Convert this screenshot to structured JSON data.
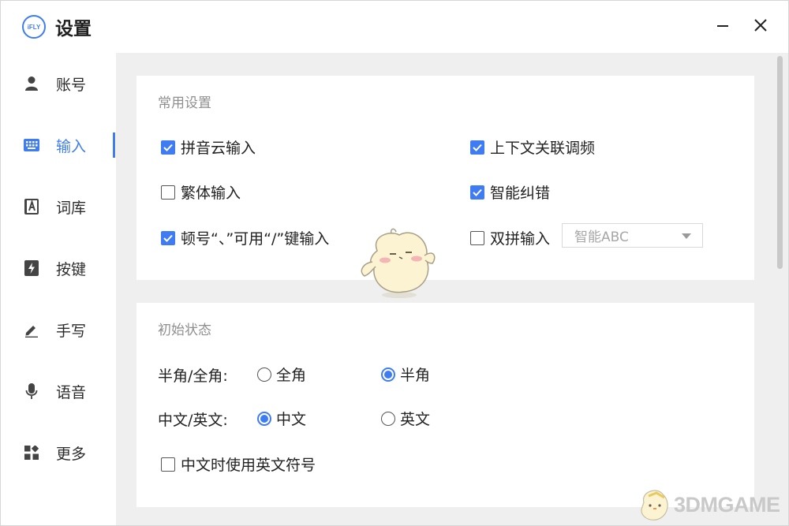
{
  "app": {
    "logo_text": "iFLY",
    "title": "设置"
  },
  "sidebar": {
    "items": [
      {
        "label": "账号",
        "icon": "user-icon"
      },
      {
        "label": "输入",
        "icon": "keyboard-icon",
        "active": true
      },
      {
        "label": "词库",
        "icon": "dictionary-icon"
      },
      {
        "label": "按键",
        "icon": "key-flash-icon"
      },
      {
        "label": "手写",
        "icon": "pen-icon"
      },
      {
        "label": "语音",
        "icon": "microphone-icon"
      },
      {
        "label": "更多",
        "icon": "more-grid-icon"
      }
    ]
  },
  "window_controls": {
    "minimize": "minimize-icon",
    "close": "close-icon"
  },
  "common": {
    "title": "常用设置",
    "options": {
      "pinyin_cloud": {
        "label": "拼音云输入",
        "checked": true
      },
      "context_freq": {
        "label": "上下文关联调频",
        "checked": true
      },
      "traditional": {
        "label": "繁体输入",
        "checked": false
      },
      "smart_correct": {
        "label": "智能纠错",
        "checked": true
      },
      "slash_pause": {
        "label": "顿号“、”可用“/”键输入",
        "checked": true
      },
      "double_pinyin": {
        "label": "双拼输入",
        "checked": false
      }
    },
    "scheme_select": {
      "value": "智能ABC"
    }
  },
  "initial": {
    "title": "初始状态",
    "width": {
      "label": "半角/全角:",
      "options": [
        "全角",
        "半角"
      ],
      "selected": "半角"
    },
    "lang": {
      "label": "中文/英文:",
      "options": [
        "中文",
        "英文"
      ],
      "selected": "中文"
    },
    "en_punct": {
      "label": "中文时使用英文符号",
      "checked": false
    }
  },
  "watermark": {
    "text": "3DMGAME"
  },
  "colors": {
    "accent": "#3f7cf3",
    "background": "#efeff0",
    "card": "#ffffff",
    "muted_text": "#8f8f8f"
  }
}
